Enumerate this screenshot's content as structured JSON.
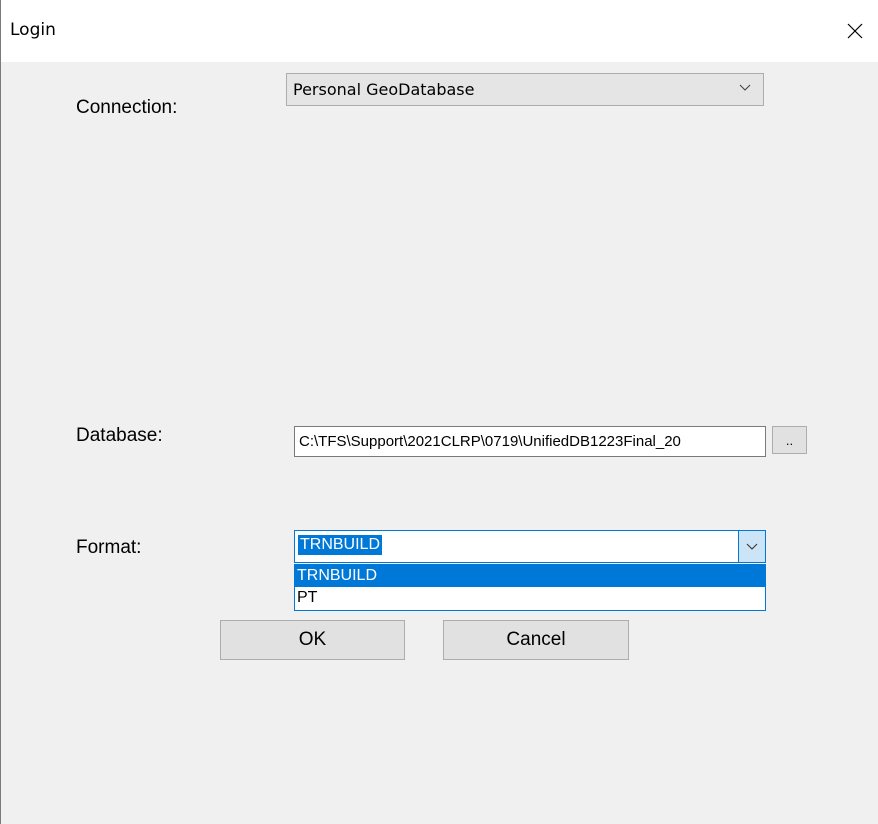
{
  "window": {
    "title": "Login"
  },
  "connection": {
    "label": "Connection:",
    "value": "Personal GeoDatabase"
  },
  "database": {
    "label": "Database:",
    "value": "C:\\TFS\\Support\\2021CLRP\\0719\\UnifiedDB1223Final_20",
    "browse_label": ".."
  },
  "format": {
    "label": "Format:",
    "value": "TRNBUILD",
    "options": [
      "TRNBUILD",
      "PT"
    ]
  },
  "buttons": {
    "ok": "OK",
    "cancel": "Cancel"
  },
  "colors": {
    "accent": "#0078d7",
    "dialog_bg": "#f0f0f0",
    "button_bg": "#e1e1e1"
  },
  "icons": {
    "close": "close-icon",
    "dropdown": "chevron-down-icon"
  }
}
